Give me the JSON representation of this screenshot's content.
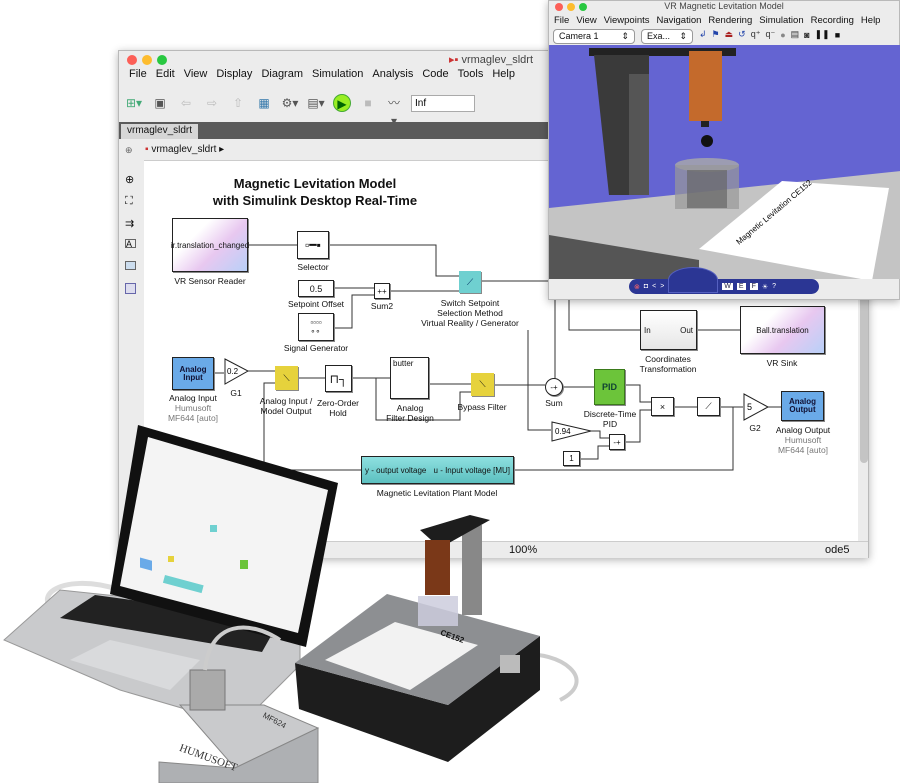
{
  "simulink": {
    "window_title": "vrmaglev_sldrt",
    "menu": [
      "File",
      "Edit",
      "View",
      "Display",
      "Diagram",
      "Simulation",
      "Analysis",
      "Code",
      "Tools",
      "Help"
    ],
    "stop_time": "Inf",
    "tab": "vrmaglev_sldrt",
    "breadcrumb": "vrmaglev_sldrt",
    "diagram_title_1": "Magnetic Levitation Model",
    "diagram_title_2": "with Simulink Desktop Real-Time",
    "zoom": "100%",
    "solver": "ode5",
    "blocks": {
      "vr_sensor": {
        "text": "ir.translation_changed",
        "label": "VR Sensor Reader"
      },
      "selector": {
        "label": "Selector"
      },
      "setpoint_offset": {
        "value": "0.5",
        "label": "Setpoint Offset"
      },
      "signal_generator": {
        "label": "Signal Generator"
      },
      "sum2": {
        "label": "Sum2",
        "signs": "++"
      },
      "switch_setpoint": {
        "label1": "Switch Setpoint",
        "label2": "Selection Method",
        "label3": "Virtual Reality / Generator"
      },
      "analog_input": {
        "text": "Analog Input",
        "label": "Analog Input",
        "sub1": "Humusoft",
        "sub2": "MF644 [auto]"
      },
      "g1": {
        "value": "0.2",
        "label": "G1"
      },
      "ai_switch": {
        "label1": "Analog Input /",
        "label2": "Model Output"
      },
      "zoh": {
        "label1": "Zero-Order",
        "label2": "Hold"
      },
      "filter": {
        "text": "butter",
        "label1": "Analog",
        "label2": "Filter Design"
      },
      "bypass": {
        "label": "Bypass Filter"
      },
      "coord": {
        "in": "In",
        "out": "Out",
        "label1": "Coordinates",
        "label2": "Transformation"
      },
      "vr_sink": {
        "text": "Ball.translation",
        "label": "VR Sink"
      },
      "sum": {
        "label": "Sum",
        "signs": "-+"
      },
      "pid": {
        "text": "PID",
        "label1": "Discrete-Time",
        "label2": "PID"
      },
      "gain094": {
        "value": "0.94"
      },
      "sum3": {
        "signs": "-+"
      },
      "const1": {
        "value": "1"
      },
      "product": {
        "text": "×"
      },
      "g2": {
        "value": "5",
        "label": "G2"
      },
      "analog_output": {
        "text": "Analog Output",
        "label": "Analog Output",
        "sub1": "Humusoft",
        "sub2": "MF644 [auto]"
      },
      "plant": {
        "left": "y - output voltage",
        "right": "u - Input voltage [MU]",
        "label": "Magnetic Levitation Plant Model"
      }
    }
  },
  "vr": {
    "window_title": "VR Magnetic Levitation Model",
    "menu": [
      "File",
      "View",
      "Viewpoints",
      "Navigation",
      "Rendering",
      "Simulation",
      "Recording",
      "Help"
    ],
    "viewpoint": "Camera 1",
    "nav_mode": "Exa...",
    "nav_buttons": [
      "W",
      "E",
      "F"
    ],
    "paper_text": "Magnetic Levitation CE152",
    "colors": {
      "sky": "#6464d2",
      "floor": "#c4c4c4",
      "coil": "#c46a2c",
      "nav_panel": "#2b3694"
    }
  },
  "hardware": {
    "plant_logo": "CE152",
    "card_logo": "HUMUSOFT",
    "card_model": "MF624"
  },
  "colors": {
    "analog_io": "#6aaae8",
    "switch": "#e6d23c",
    "cyan": "#6fd0d0",
    "pid": "#6cc43a"
  }
}
